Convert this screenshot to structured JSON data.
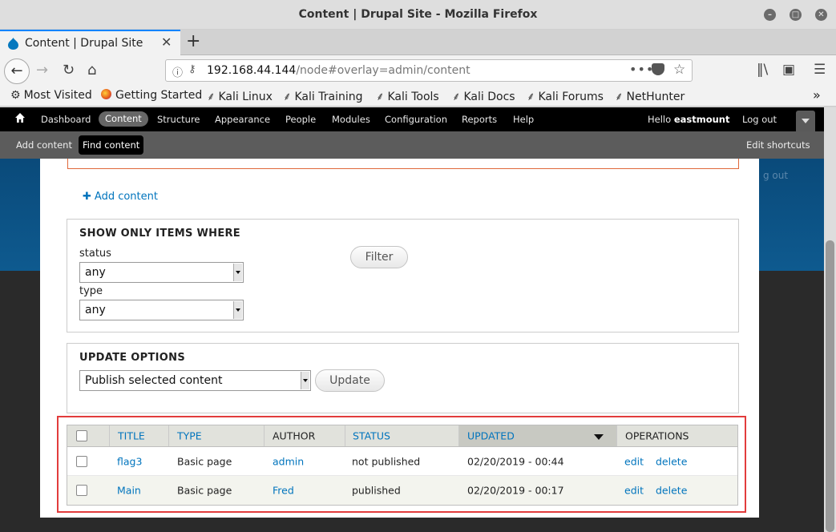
{
  "window": {
    "title": "Content | Drupal Site - Mozilla Firefox"
  },
  "tab": {
    "label": "Content | Drupal Site"
  },
  "url": {
    "host": "192.168.44.144",
    "path": "/node#overlay=admin/content"
  },
  "bookmarks": [
    "Most Visited",
    "Getting Started",
    "Kali Linux",
    "Kali Training",
    "Kali Tools",
    "Kali Docs",
    "Kali Forums",
    "NetHunter"
  ],
  "toolbar": {
    "items": [
      "Dashboard",
      "Content",
      "Structure",
      "Appearance",
      "People",
      "Modules",
      "Configuration",
      "Reports",
      "Help"
    ],
    "hello_prefix": "Hello",
    "username": "eastmount",
    "logout": "Log out"
  },
  "shortcuts": {
    "add_content": "Add content",
    "find_content": "Find content",
    "edit_shortcuts": "Edit shortcuts"
  },
  "background": {
    "logout_fragment": "g out"
  },
  "page": {
    "add_content_link": "Add content"
  },
  "filter": {
    "legend": "SHOW ONLY ITEMS WHERE",
    "status_label": "status",
    "status_value": "any",
    "type_label": "type",
    "type_value": "any",
    "button": "Filter"
  },
  "update_options": {
    "legend": "UPDATE OPTIONS",
    "action_value": "Publish selected content",
    "button": "Update"
  },
  "table": {
    "headers": {
      "title": "TITLE",
      "type": "TYPE",
      "author": "AUTHOR",
      "status": "STATUS",
      "updated": "UPDATED",
      "operations": "OPERATIONS"
    },
    "rows": [
      {
        "title": "flag3",
        "type": "Basic page",
        "author": "admin",
        "status": "not published",
        "updated": "02/20/2019 - 00:44",
        "edit": "edit",
        "delete": "delete"
      },
      {
        "title": "Main",
        "type": "Basic page",
        "author": "Fred",
        "status": "published",
        "updated": "02/20/2019 - 00:17",
        "edit": "edit",
        "delete": "delete"
      }
    ]
  },
  "colors": {
    "link": "#0074bd",
    "highlight_border": "#e23c3c",
    "toolbar_bg": "#000000",
    "shortcut_bg": "#5c5c5c"
  }
}
